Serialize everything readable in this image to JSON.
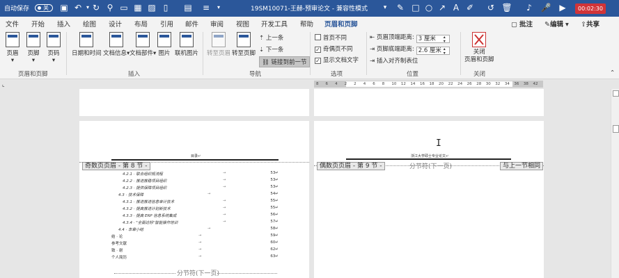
{
  "titlebar": {
    "autosave_label": "自动保存",
    "autosave_state": "关",
    "doc_title": "19SM10071-王赫-预审论文 - 兼容性模式",
    "recording_time": "00:02:30"
  },
  "tabs": [
    "文件",
    "开始",
    "插入",
    "绘图",
    "设计",
    "布局",
    "引用",
    "邮件",
    "审阅",
    "视图",
    "开发工具",
    "帮助",
    "页眉和页脚"
  ],
  "right_actions": {
    "comment": "批注",
    "edit": "编辑",
    "share": "共享"
  },
  "ribbon": {
    "group_header_footer": {
      "label": "页眉和页脚",
      "buttons": [
        "页眉",
        "页脚",
        "页码"
      ]
    },
    "group_insert": {
      "label": "插入",
      "buttons": [
        "日期和时间",
        "文档信息",
        "文档部件",
        "图片",
        "联机图片"
      ]
    },
    "group_nav": {
      "label": "导航",
      "goto_header": "转至页眉",
      "goto_footer": "转至页脚",
      "prev": "上一条",
      "next": "下一条",
      "link_prev": "链接到前一节"
    },
    "group_options": {
      "label": "选项",
      "diff_first": "首页不同",
      "diff_odd_even": "奇偶页不同",
      "show_text": "显示文档文字"
    },
    "group_position": {
      "label": "位置",
      "header_top_label": "页眉顶端距离:",
      "header_top_value": "3 厘米",
      "footer_bottom_label": "页脚底端距离:",
      "footer_bottom_value": "2.6 厘米",
      "insert_align_tab": "插入对齐制表位"
    },
    "group_close": {
      "label": "关闭",
      "close_button": "关闭\n页眉和页脚"
    }
  },
  "ruler_numbers": [
    "8",
    "6",
    "4",
    "2",
    "2",
    "4",
    "6",
    "8",
    "10",
    "12",
    "14",
    "16",
    "18",
    "20",
    "22",
    "24",
    "26",
    "28",
    "30",
    "32",
    "34",
    "36",
    "38",
    "42"
  ],
  "left_page": {
    "header_text": "目录↵",
    "header_tag": "奇数页页眉 - 第 8 节 -",
    "section_break": "分节符(下一页)",
    "toc": [
      {
        "text": "4.2.1 · 联合组织规流程",
        "page": "53↵"
      },
      {
        "text": "4.2.2 · 推进推稳项目组织",
        "page": "53↵"
      },
      {
        "text": "4.2.3 · 提供保障项目组织",
        "page": "53↵"
      },
      {
        "text": "4.3 · 技术保障",
        "page": "54↵"
      },
      {
        "text": "4.3.1 · 推进推进信息审计技术",
        "page": "55↵"
      },
      {
        "text": "4.3.2 · 提高推进计划新技术",
        "page": "55↵"
      },
      {
        "text": "4.3.3 · 提高 ERP 信息系统集成",
        "page": "56↵"
      },
      {
        "text": "4.3.4 · \"全面达标\"智能操作培训",
        "page": "57↵"
      },
      {
        "text": "4.4 · 本章小结",
        "page": "58↵"
      },
      {
        "text": "结 · 论",
        "page": "59↵"
      },
      {
        "text": "参考文献",
        "page": "60↵"
      },
      {
        "text": "致 · 谢",
        "page": "62↵"
      },
      {
        "text": "个人简历",
        "page": "63↵"
      }
    ]
  },
  "right_page": {
    "header_text": "浙江大学硕士专业论文↵",
    "header_tag": "偶数页页眉 - 第 9 节 -",
    "section_break": "分节符(下一页)",
    "same_as_prev": "与上一节相同"
  }
}
